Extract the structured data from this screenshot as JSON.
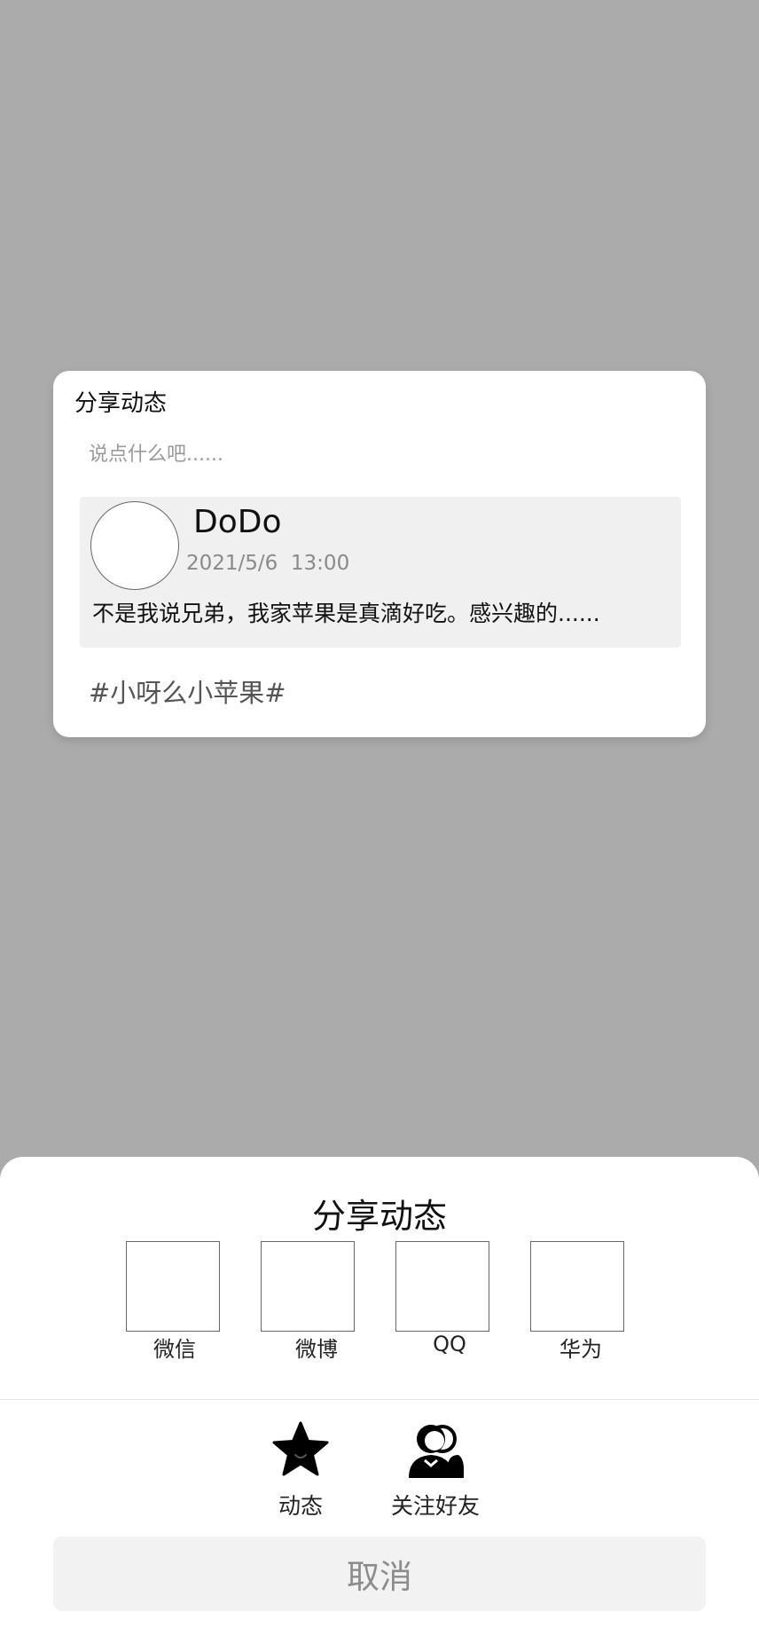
{
  "share_card": {
    "title": "分享动态",
    "input_placeholder": "说点什么吧......",
    "post": {
      "author": "DoDo",
      "time": "2021/5/6  13:00",
      "text": "不是我说兄弟，我家苹果是真滴好吃。感兴趣的......"
    },
    "hashtag": "#小呀么小苹果#"
  },
  "sheet": {
    "title": "分享动态",
    "platforms": [
      {
        "label": "微信"
      },
      {
        "label": "微博"
      },
      {
        "label": "QQ"
      },
      {
        "label": "华为"
      }
    ],
    "actions": [
      {
        "label": "动态",
        "icon": "star-icon"
      },
      {
        "label": "关注好友",
        "icon": "friends-icon"
      }
    ],
    "cancel_label": "取消"
  },
  "colors": {
    "overlay": "#ababab",
    "surface": "#ffffff",
    "post_background": "#f0f0f0",
    "muted_text": "#8a8a8a"
  }
}
